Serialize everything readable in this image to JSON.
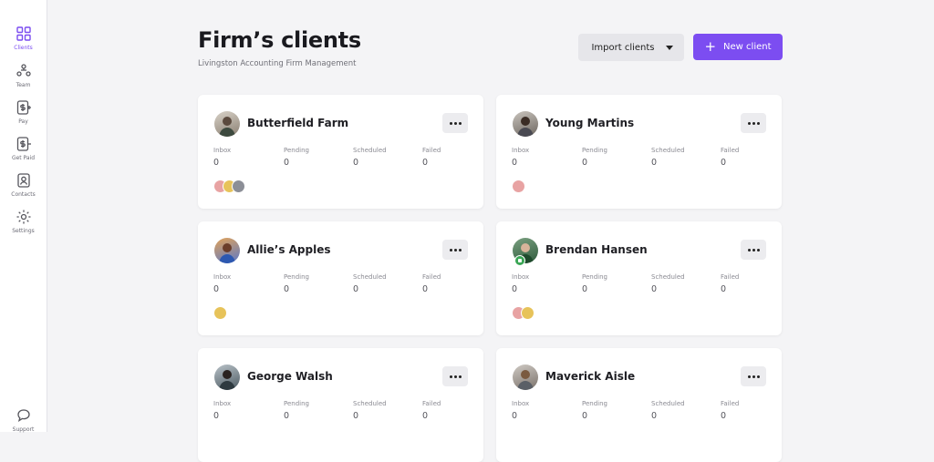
{
  "sidebar": {
    "items": [
      {
        "label": "Clients",
        "icon": "grid-icon",
        "active": true
      },
      {
        "label": "Team",
        "icon": "team-icon",
        "active": false
      },
      {
        "label": "Pay",
        "icon": "pay-icon",
        "active": false
      },
      {
        "label": "Get Paid",
        "icon": "get-paid-icon",
        "active": false
      },
      {
        "label": "Contacts",
        "icon": "contacts-icon",
        "active": false
      },
      {
        "label": "Settings",
        "icon": "gear-icon",
        "active": false
      }
    ],
    "support_label": "Support"
  },
  "header": {
    "title": "Firm’s clients",
    "subtitle": "Livingston Accounting Firm Management",
    "import_label": "Import clients",
    "new_label": "New client"
  },
  "stat_labels": [
    "Inbox",
    "Pending",
    "Scheduled",
    "Failed"
  ],
  "clients": [
    {
      "name": "Butterfield Farm",
      "stats": [
        "0",
        "0",
        "0",
        "0"
      ],
      "members": 3
    },
    {
      "name": "Young Martins",
      "stats": [
        "0",
        "0",
        "0",
        "0"
      ],
      "members": 1
    },
    {
      "name": "Allie’s Apples",
      "stats": [
        "0",
        "0",
        "0",
        "0"
      ],
      "members": 1
    },
    {
      "name": "Brendan Hansen",
      "stats": [
        "0",
        "0",
        "0",
        "0"
      ],
      "members": 2
    },
    {
      "name": "George Walsh",
      "stats": [
        "0",
        "0",
        "0",
        "0"
      ],
      "members": 0
    },
    {
      "name": "Maverick Aisle",
      "stats": [
        "0",
        "0",
        "0",
        "0"
      ],
      "members": 0
    }
  ],
  "colors": {
    "accent": "#7c4df1",
    "badge": "#3aa655"
  }
}
